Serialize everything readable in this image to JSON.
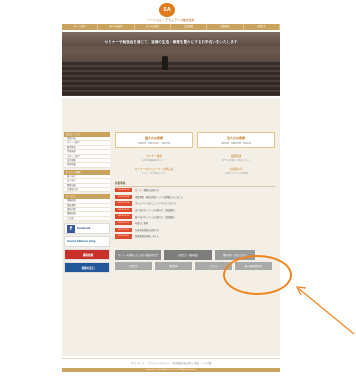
{
  "header": {
    "logo_text": "SA",
    "company_name": "ソーシャル・アライアンス株式会社"
  },
  "nav": [
    "グループ紹介",
    "個人のお客様",
    "法人のお客様",
    "会社概要",
    "採用情報",
    "お問合せ"
  ],
  "hero": {
    "caption": "セミナーや勉強会を通じて、皆様の生活・事業を豊かにするお手伝いをいたします"
  },
  "sidebar": {
    "sections": [
      {
        "header": "会社について",
        "items": [
          "事業内容",
          "グループ紹介",
          "経営理念",
          "代表挨拶",
          "スタッフ紹介",
          "会社概要",
          "採用情報"
        ]
      },
      {
        "header": "セミナー情報",
        "items": [
          "個人向け",
          "法人向け",
          "開催実績",
          "お客様の声"
        ]
      },
      {
        "header": "サービス",
        "items": [
          "保険相談",
          "資産運用",
          "相続対策",
          "税務相談",
          "その他"
        ]
      }
    ],
    "banners": {
      "facebook": "facebook",
      "blog": "Social Alliance blog",
      "red": "講演依頼",
      "blue": "保険の窓口"
    }
  },
  "main": {
    "cards": [
      {
        "title": "個人のお客様",
        "sub": "資産形成・保険の見直し・相続対策"
      },
      {
        "title": "法人のお客様",
        "sub": "事業承継・退職金準備・税務対策"
      }
    ],
    "links": [
      {
        "title": "セミナー情報",
        "sub": "お得な情報満載のセミナー"
      },
      {
        "title": "保険相談",
        "sub": "何でもお気軽にご相談ください"
      },
      {
        "title": "セミナースケジュール・お申込み",
        "sub": "セミナーのご案内はこちら"
      },
      {
        "title": "お客様の声",
        "sub": "ご参加いただいた方の感想"
      }
    ],
    "news_title": "新着情報",
    "news": [
      {
        "badge": "2014.03.10",
        "text": "セミナー開催のお知らせ"
      },
      {
        "badge": "2014.02.28",
        "text": "事業承継・相続対策セミナーを開催いたしました"
      },
      {
        "badge": "2014.02.14",
        "text": "ホームページをリニューアルいたしました"
      },
      {
        "badge": "2014.02.03",
        "text": "法人向けセミナーのお知らせ（満員御礼）"
      },
      {
        "badge": "2014.01.20",
        "text": "個人向けセミナーのお知らせ（満員御礼）"
      },
      {
        "badge": "2014.01.10",
        "text": "年始のご挨拶"
      },
      {
        "badge": "2013.12.20",
        "text": "年末年始休業のお知らせ"
      },
      {
        "badge": "2013.12.01",
        "text": "採用情報を更新しました"
      }
    ],
    "buttons_top": [
      "セミナーを開催いたします 各種お問合せ",
      "お問合せ・無料相談",
      "資料請求・お問い合わせ"
    ],
    "buttons_bottom": [
      "お問合せ",
      "資料請求",
      "アクセス",
      "個人情報保護方針"
    ]
  },
  "footer": {
    "links": "サイトマップ ｜ プライバシーポリシー ｜ 特定商取引法に基づく表記 ｜ リンク集",
    "copyright": "Copyright © Social Alliance Co.,Ltd. All Rights Reserved."
  },
  "colors": {
    "accent": "#c9a35e",
    "orange": "#f0841f",
    "news_badge": "#e04a2c"
  }
}
